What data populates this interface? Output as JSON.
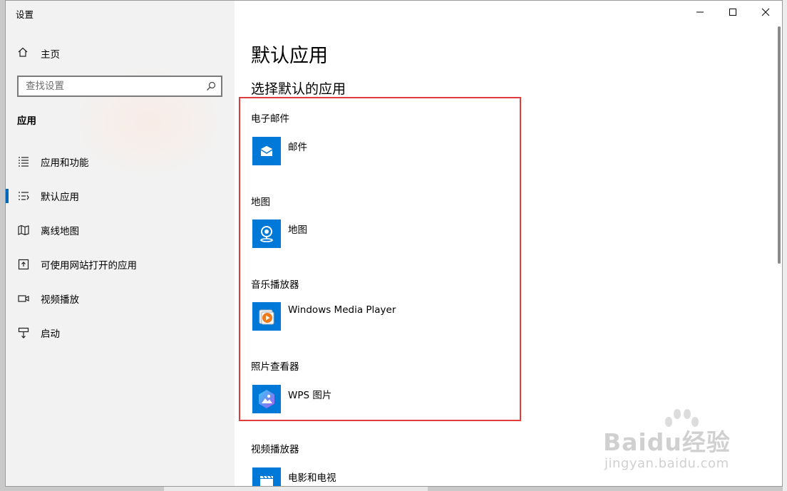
{
  "window": {
    "title": "设置"
  },
  "sidebar": {
    "home_label": "主页",
    "search_placeholder": "查找设置",
    "section_title": "应用",
    "items": [
      {
        "label": "应用和功能",
        "icon": "apps-features-icon",
        "active": false
      },
      {
        "label": "默认应用",
        "icon": "default-apps-icon",
        "active": true
      },
      {
        "label": "离线地图",
        "icon": "offline-maps-icon",
        "active": false
      },
      {
        "label": "可使用网站打开的应用",
        "icon": "apps-for-websites-icon",
        "active": false
      },
      {
        "label": "视频播放",
        "icon": "video-playback-icon",
        "active": false
      },
      {
        "label": "启动",
        "icon": "startup-icon",
        "active": false
      }
    ]
  },
  "main": {
    "title": "默认应用",
    "subtitle": "选择默认的应用",
    "categories": [
      {
        "label": "电子邮件",
        "app": "邮件",
        "icon": "mail-app-icon"
      },
      {
        "label": "地图",
        "app": "地图",
        "icon": "maps-app-icon"
      },
      {
        "label": "音乐播放器",
        "app": "Windows Media Player",
        "icon": "windows-media-player-icon"
      },
      {
        "label": "照片查看器",
        "app": "WPS 图片",
        "icon": "wps-pictures-icon"
      },
      {
        "label": "视频播放器",
        "app": "电影和电视",
        "icon": "movies-tv-icon"
      }
    ]
  },
  "watermark": {
    "logo": "Baidu经验",
    "url": "jingyan.baidu.com"
  },
  "colors": {
    "accent": "#0078d7",
    "highlight_border": "#e03c3c",
    "sidebar_bg": "#f2f2f2"
  }
}
